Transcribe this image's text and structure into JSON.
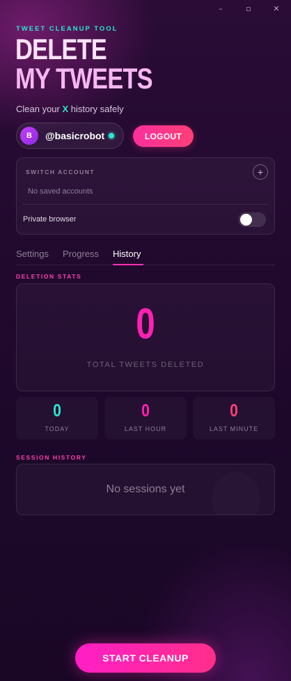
{
  "window_controls": {
    "minimize": "–",
    "maximize": "▫",
    "close": "✕"
  },
  "header": {
    "tagline": "TWEET CLEANUP TOOL",
    "title_line1": "DELETE",
    "title_line2": "MY TWEETS",
    "subtitle_prefix": "Clean your ",
    "subtitle_x": "X",
    "subtitle_suffix": " history safely"
  },
  "account": {
    "avatar_initial": "B",
    "handle": "@basicrobot",
    "status": "online",
    "logout_label": "LOGOUT"
  },
  "switch_account": {
    "label": "SWITCH ACCOUNT",
    "add_icon": "+",
    "empty_text": "No saved accounts",
    "private_browser_label": "Private browser",
    "private_browser_enabled": false
  },
  "tabs": [
    {
      "label": "Settings",
      "active": false
    },
    {
      "label": "Progress",
      "active": false
    },
    {
      "label": "History",
      "active": true
    }
  ],
  "stats": {
    "section_label": "DELETION STATS",
    "total": "0",
    "total_caption": "TOTAL TWEETS DELETED",
    "cards": [
      {
        "value": "0",
        "caption": "TODAY",
        "color": "#28e6cf"
      },
      {
        "value": "0",
        "caption": "LAST HOUR",
        "color": "#ff20b4"
      },
      {
        "value": "0",
        "caption": "LAST MINUTE",
        "color": "#ff3f76"
      }
    ]
  },
  "history": {
    "section_label": "SESSION HISTORY",
    "empty_text": "No sessions yet"
  },
  "actions": {
    "start_label": "START CLEANUP"
  },
  "colors": {
    "accent_pink": "#ff20b4",
    "accent_teal": "#28e6cf",
    "accent_red": "#ff3f76"
  }
}
